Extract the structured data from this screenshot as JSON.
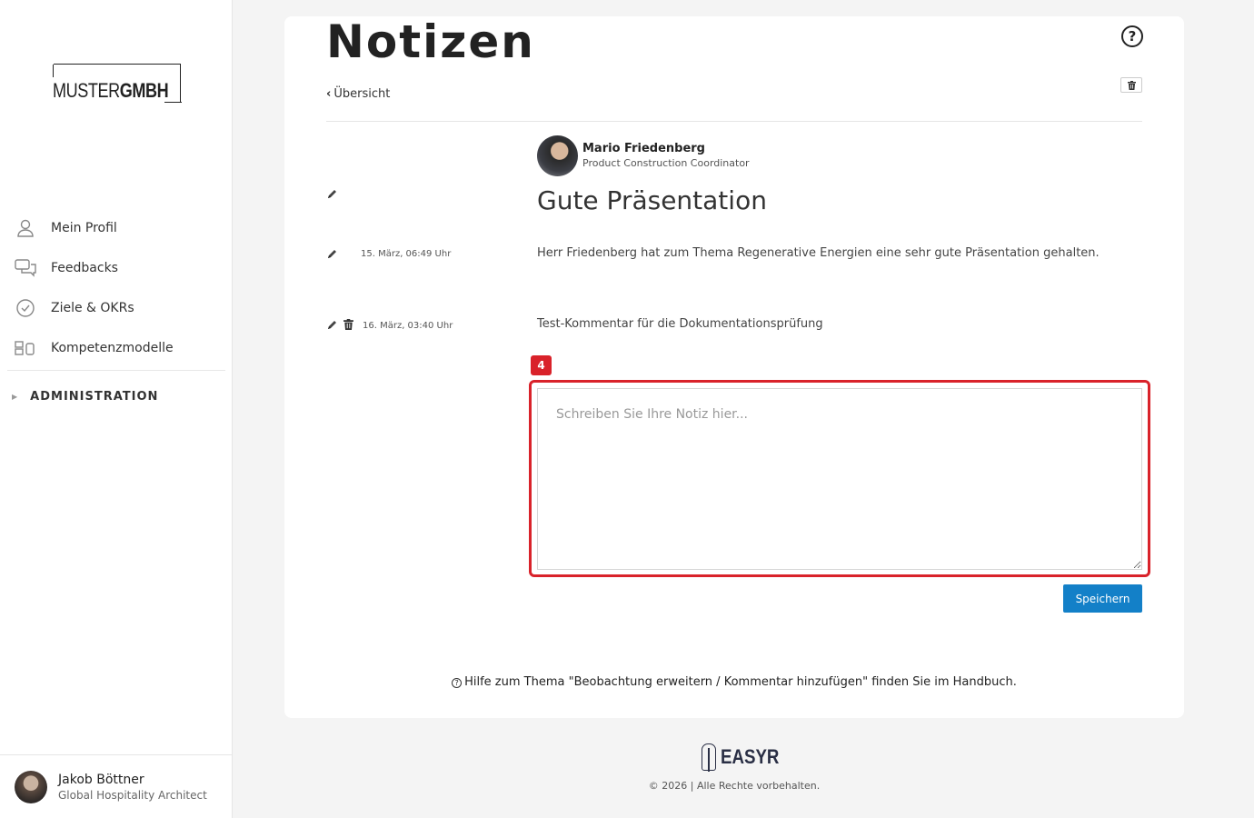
{
  "sidebar": {
    "logo": {
      "part1": "MUSTER",
      "part2": "GMBH"
    },
    "nav": [
      {
        "label": "Mein Profil",
        "icon": "user-icon"
      },
      {
        "label": "Feedbacks",
        "icon": "chat-bubbles-icon"
      },
      {
        "label": "Ziele & OKRs",
        "icon": "check-circle-icon"
      },
      {
        "label": "Kompetenzmodelle",
        "icon": "blocks-icon"
      }
    ],
    "admin_label": "ADMINISTRATION",
    "user": {
      "name": "Jakob Böttner",
      "role": "Global Hospitality Architect"
    }
  },
  "page": {
    "title": "Notizen",
    "back_label": "Übersicht",
    "help_icon": "help-circle-icon",
    "trash_icon": "trash-icon"
  },
  "note": {
    "person_name": "Mario Friedenberg",
    "person_role": "Product Construction Coordinator",
    "title": "Gute Präsentation",
    "entries": [
      {
        "date": "15. März, 06:49 Uhr",
        "text": "Herr Friedenberg hat zum Thema Regenerative Energien eine sehr gute Präsentation gehalten."
      },
      {
        "date": "16. März, 03:40 Uhr",
        "text": "Test-Kommentar für die Dokumentationsprüfung"
      }
    ]
  },
  "editor": {
    "badge": "4",
    "placeholder": "Schreiben Sie Ihre Notiz hier...",
    "value": "",
    "save_label": "Speichern"
  },
  "hint": "Hilfe zum Thema \"Beobachtung erweitern / Kommentar hinzufügen\" finden Sie im Handbuch.",
  "footer": {
    "brand": "EASYR",
    "copyright": "© 2026 | Alle Rechte vorbehalten."
  },
  "colors": {
    "accent": "#1380c8",
    "highlight": "#d9222a"
  }
}
